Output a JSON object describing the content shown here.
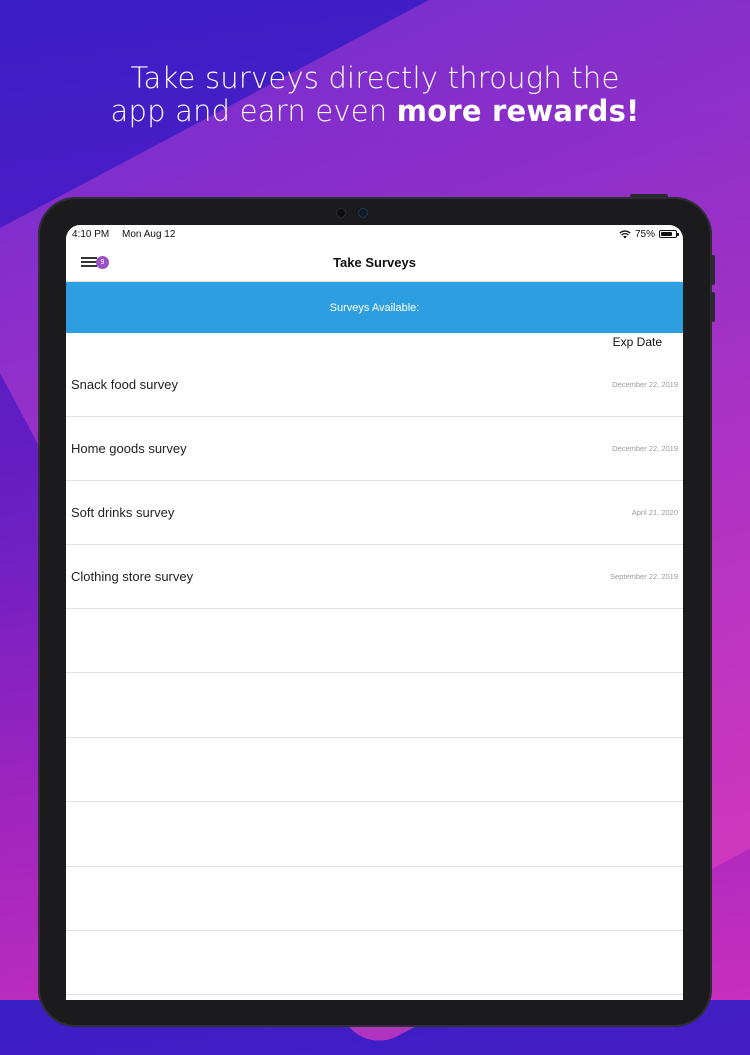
{
  "headline": {
    "line1": "Take surveys directly through the",
    "line2_prefix": "app and earn even ",
    "line2_bold": "more rewards!"
  },
  "status_bar": {
    "time": "4:10 PM",
    "date": "Mon Aug 12",
    "battery": "75%"
  },
  "nav": {
    "title": "Take Surveys",
    "menu_badge": "9",
    "menu_icon": "hamburger-menu-icon"
  },
  "banner": {
    "text": "Surveys Available:"
  },
  "table": {
    "exp_header": "Exp Date",
    "rows": [
      {
        "name": "Snack food survey",
        "date": "December 22, 2019"
      },
      {
        "name": "Home goods survey",
        "date": "December 22, 2019"
      },
      {
        "name": "Soft drinks survey",
        "date": "April 21, 2020"
      },
      {
        "name": "Clothing store survey",
        "date": "September 22, 2019"
      }
    ]
  },
  "colors": {
    "banner": "#2d9fe0",
    "badge": "#9b51c5",
    "background_top": "#3a1fc4",
    "background_bottom": "#c72fbd"
  }
}
